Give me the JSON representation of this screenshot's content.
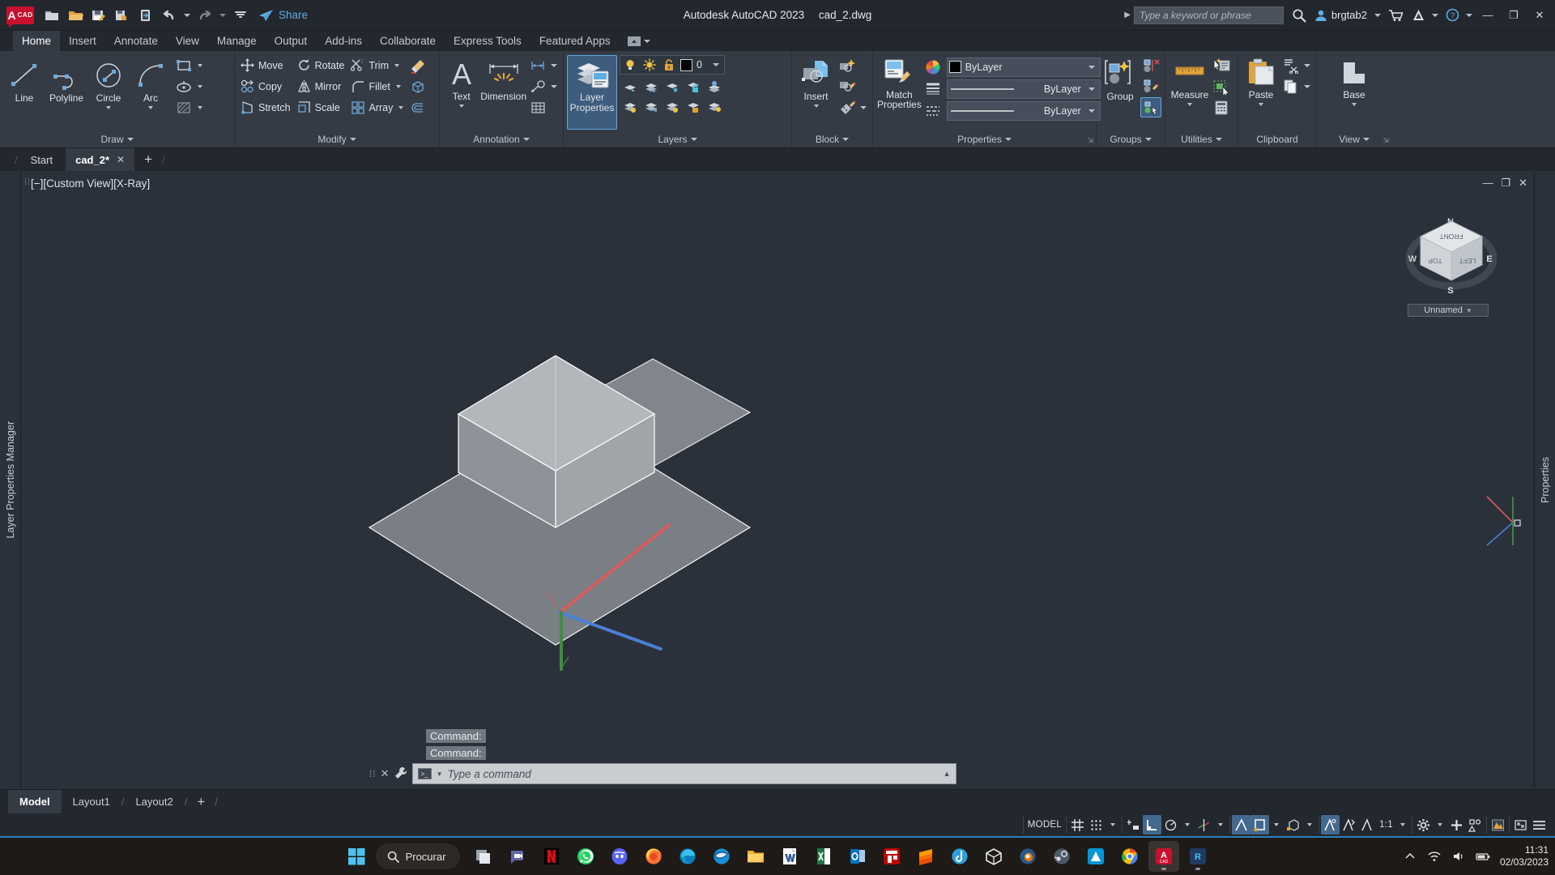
{
  "window": {
    "app_title": "Autodesk AutoCAD 2023",
    "file_name": "cad_2.dwg",
    "logo_a": "A",
    "logo_cad": "CAD",
    "share_label": "Share",
    "minimize": "—",
    "restore": "❐",
    "close": "✕"
  },
  "search": {
    "placeholder": "Type a keyword or phrase",
    "user_name": "brgtab2"
  },
  "ribbon_tabs": [
    {
      "label": "Home",
      "active": true
    },
    {
      "label": "Insert",
      "active": false
    },
    {
      "label": "Annotate",
      "active": false
    },
    {
      "label": "View",
      "active": false
    },
    {
      "label": "Manage",
      "active": false
    },
    {
      "label": "Output",
      "active": false
    },
    {
      "label": "Add-ins",
      "active": false
    },
    {
      "label": "Collaborate",
      "active": false
    },
    {
      "label": "Express Tools",
      "active": false
    },
    {
      "label": "Featured Apps",
      "active": false
    }
  ],
  "panels": {
    "draw": {
      "title": "Draw",
      "buttons": [
        {
          "label": "Line",
          "icon": "line-icon"
        },
        {
          "label": "Polyline",
          "icon": "polyline-icon"
        },
        {
          "label": "Circle",
          "icon": "circle-icon"
        },
        {
          "label": "Arc",
          "icon": "arc-icon"
        }
      ],
      "small_icons": [
        "rectangle-icon",
        "ellipse-icon",
        "hatch-icon"
      ]
    },
    "modify": {
      "title": "Modify",
      "items": [
        {
          "label": "Move",
          "icon": "move-icon"
        },
        {
          "label": "Rotate",
          "icon": "rotate-icon"
        },
        {
          "label": "Trim",
          "icon": "trim-icon"
        },
        {
          "label": "Copy",
          "icon": "copy-icon"
        },
        {
          "label": "Mirror",
          "icon": "mirror-icon"
        },
        {
          "label": "Fillet",
          "icon": "fillet-icon"
        },
        {
          "label": "Stretch",
          "icon": "stretch-icon"
        },
        {
          "label": "Scale",
          "icon": "scale-icon"
        },
        {
          "label": "Array",
          "icon": "array-icon"
        }
      ],
      "extra_icons": [
        "erase-icon",
        "explode-icon",
        "offset-icon"
      ]
    },
    "annotation": {
      "title": "Annotation",
      "text_label": "Text",
      "dimension_label": "Dimension",
      "small_icons": [
        "linear-dimension-icon",
        "leader-icon",
        "table-icon"
      ]
    },
    "layers": {
      "title": "Layers",
      "layer_properties_label": "Layer Properties",
      "current_layer": "0",
      "state_icons": [
        "lightbulb-on-icon",
        "sun-icon",
        "unlock-icon"
      ]
    },
    "block": {
      "title": "Block",
      "insert_label": "Insert",
      "icons": [
        "create-block-icon",
        "edit-block-icon",
        "set-attributes-icon"
      ]
    },
    "properties": {
      "title": "Properties",
      "match_properties_label": "Match Properties",
      "color": "ByLayer",
      "lineweight": "ByLayer",
      "linetype": "ByLayer",
      "color_swatch": "#000000"
    },
    "groups": {
      "title": "Groups",
      "group_label": "Group",
      "icons": [
        "group-icon",
        "ungroup-icon",
        "edit-group-icon",
        "group-selection-on-icon"
      ]
    },
    "utilities": {
      "title": "Utilities",
      "measure_label": "Measure",
      "icons": [
        "ruler-icon",
        "quick-select-icon",
        "select-similar-icon",
        "calculator-icon"
      ]
    },
    "clipboard": {
      "title": "Clipboard",
      "paste_label": "Paste",
      "icons": [
        "paste-icon",
        "cut-icon",
        "copy-clip-icon"
      ]
    },
    "view": {
      "title": "View",
      "base_label": "Base"
    }
  },
  "file_tabs": [
    {
      "label": "Start",
      "active": false,
      "closable": false
    },
    {
      "label": "cad_2*",
      "active": true,
      "closable": true
    }
  ],
  "file_tab_add": "+",
  "viewport": {
    "label": "[−][Custom View][X-Ray]",
    "view_name": "Unnamed",
    "cube_faces": {
      "front": "FRONT",
      "top": "TOP",
      "left": "LEFT"
    },
    "compass": {
      "n": "N",
      "s": "S",
      "e": "E",
      "w": "W"
    },
    "controls": {
      "minimize": "—",
      "restore": "❐",
      "close": "✕"
    }
  },
  "palettes": {
    "left_label": "Layer Properties Manager",
    "right_label": "Properties"
  },
  "command_window": {
    "history": [
      "Command:",
      "Command:"
    ],
    "placeholder": "Type a command"
  },
  "layout_tabs": [
    {
      "label": "Model",
      "active": true
    },
    {
      "label": "Layout1",
      "active": false
    },
    {
      "label": "Layout2",
      "active": false
    }
  ],
  "layout_add": "+",
  "status_bar": {
    "model_label": "MODEL",
    "scale": "1:1",
    "items": [
      {
        "name": "grid-display",
        "on": false
      },
      {
        "name": "snap-mode",
        "on": false
      },
      {
        "name": "infer-constraints",
        "on": false
      },
      {
        "name": "ortho-mode",
        "on": true
      },
      {
        "name": "polar-tracking",
        "on": false
      },
      {
        "name": "isometric-drafting",
        "on": false
      },
      {
        "name": "object-snap-tracking",
        "on": true
      },
      {
        "name": "object-snap",
        "on": true
      },
      {
        "name": "3d-object-snap",
        "on": false
      },
      {
        "name": "annotation-visibility",
        "on": true
      },
      {
        "name": "autoscale",
        "on": false
      },
      {
        "name": "annotation-scale-list",
        "on": false
      },
      {
        "name": "workspace-switching",
        "on": false
      },
      {
        "name": "customization",
        "on": false
      },
      {
        "name": "hardware-acceleration",
        "on": false
      },
      {
        "name": "isolate-objects",
        "on": false
      },
      {
        "name": "clean-screen",
        "on": false
      }
    ]
  },
  "taskbar": {
    "search_label": "Procurar",
    "time": "11:31",
    "date": "02/03/2023",
    "apps": [
      "task-view-icon",
      "teams-icon",
      "netflix-icon",
      "whatsapp-icon",
      "discord-icon",
      "firefox-icon",
      "edge-icon",
      "thunderbird-icon",
      "file-explorer-icon",
      "word-icon",
      "excel-icon",
      "outlook-icon",
      "filezilla-icon",
      "sublime-icon",
      "qbittorrent-icon",
      "sketchup-icon",
      "blender-icon",
      "steam-icon",
      "autodesk-icon",
      "chrome-icon",
      "autocad-icon",
      "revit-icon"
    ]
  },
  "colors": {
    "ribbon_bg": "#343b45",
    "titlebar_bg": "#23272e",
    "canvas_bg": "#2b313a",
    "accent_blue": "#2f80b7",
    "selection_blue": "#3e5d7e",
    "autodesk_red": "#c8102e"
  }
}
